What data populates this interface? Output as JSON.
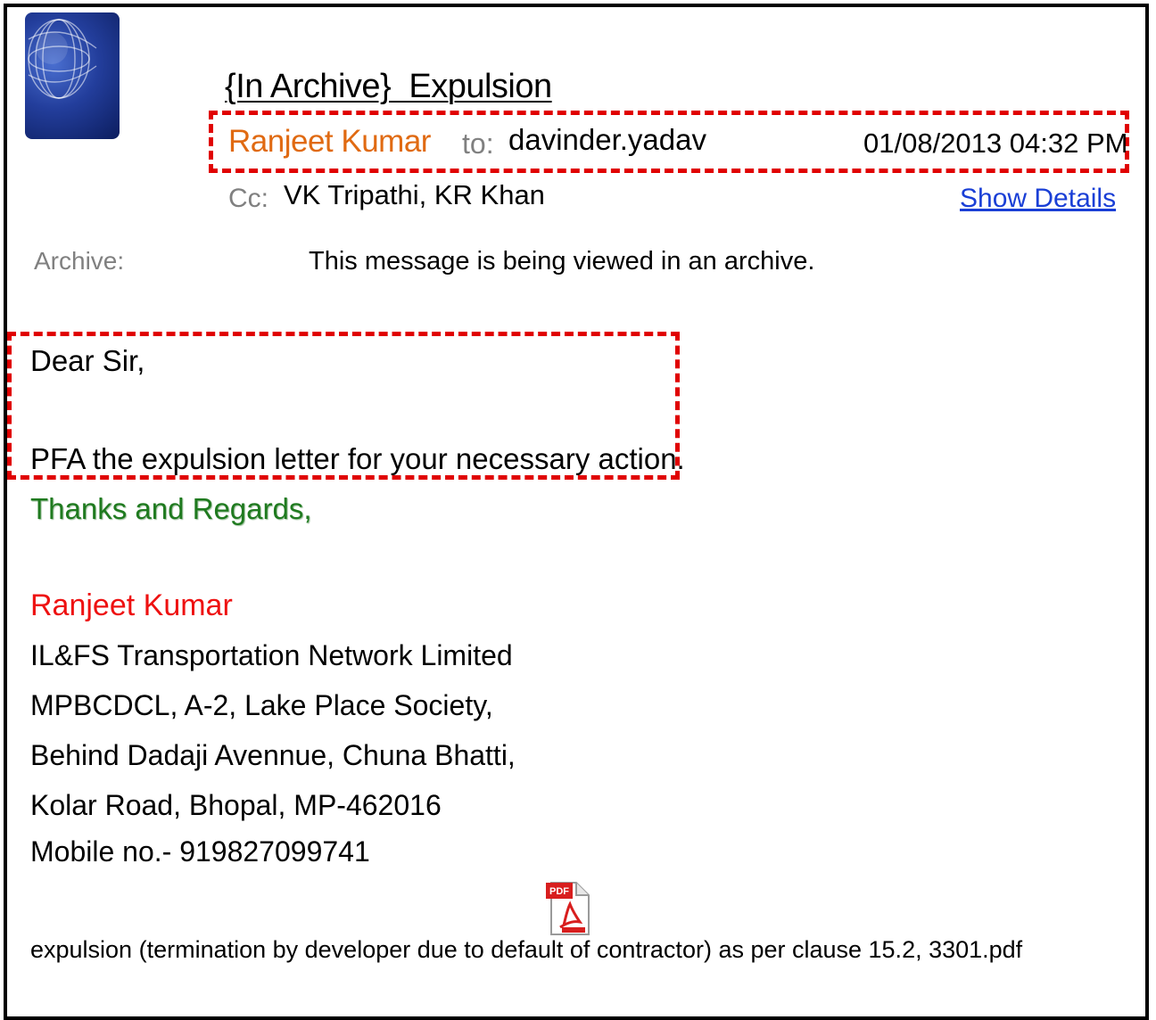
{
  "message": {
    "subject": "{In Archive}  Expulsion",
    "from": "Ranjeet Kumar",
    "to_label": "to:",
    "to": "davinder.yadav",
    "date": "01/08/2013 04:32 PM",
    "cc_label": "Cc:",
    "cc": "VK Tripathi, KR Khan",
    "show_details_label": "Show Details",
    "archive_label": "Archive:",
    "archive_text": "This message is being viewed in an archive."
  },
  "body": {
    "greeting": "Dear Sir,",
    "line1": "PFA the expulsion letter for your necessary action.",
    "closing": "Thanks and Regards,"
  },
  "signature": {
    "name": "Ranjeet Kumar",
    "lines": [
      "IL&FS Transportation Network Limited",
      "MPBCDCL, A-2, Lake Place Society,",
      "Behind Dadaji Avennue, Chuna Bhatti,",
      "Kolar Road, Bhopal, MP-462016",
      "Mobile no.- 919827099741"
    ]
  },
  "attachment": {
    "icon": "pdf-file-icon",
    "icon_badge": "PDF",
    "filename": "expulsion (termination by developer due to default of contractor) as per clause 15.2, 3301.pdf"
  },
  "colors": {
    "sender": "#e06a12",
    "closing": "#1f7a1f",
    "signature_name": "#ee1111",
    "link": "#1a3fd6",
    "highlight_box": "#e00000"
  }
}
